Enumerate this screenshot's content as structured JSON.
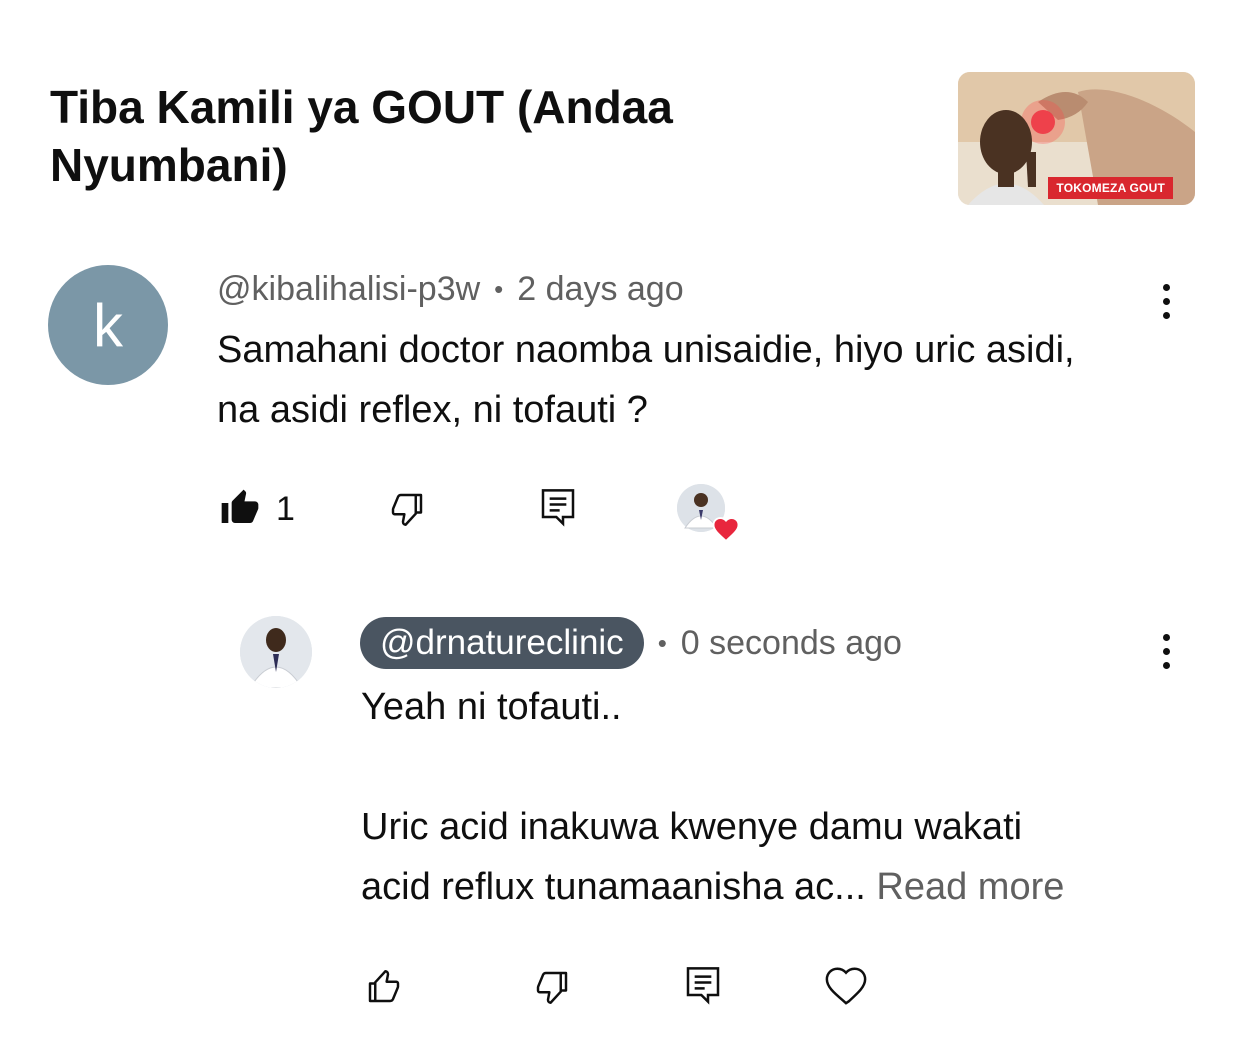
{
  "video": {
    "title": "Tiba Kamili ya GOUT (Andaa Nyumbani)",
    "thumbnail_caption": "TOKOMEZA GOUT"
  },
  "comment": {
    "avatar_letter": "k",
    "handle": "@kibalihalisi-p3w",
    "separator": "•",
    "time": "2 days ago",
    "text": "Samahani doctor naomba unisaidie, hiyo uric asidi, na asidi reflex, ni tofauti ?",
    "like_count": "1",
    "icons": {
      "like": "thumbs-up-filled-icon",
      "dislike": "thumbs-down-icon",
      "reply": "reply-icon",
      "creator_heart": "creator-heart-icon",
      "more": "more-vert-icon"
    }
  },
  "reply": {
    "handle": "@drnatureclinic",
    "separator": "•",
    "time": "0 seconds ago",
    "text_line1": "Yeah ni tofauti..",
    "text_line2": "Uric acid inakuwa kwenye damu wakati",
    "text_line3": "acid reflux tunamaanisha ac...",
    "read_more": "Read more",
    "icons": {
      "like": "thumbs-up-icon",
      "dislike": "thumbs-down-icon",
      "reply": "reply-icon",
      "heart": "heart-outline-icon",
      "more": "more-vert-icon"
    }
  },
  "colors": {
    "text_primary": "#0f0f0f",
    "text_secondary": "#606060",
    "avatar_bg": "#7b97a7",
    "handle_chip_bg": "#4a5561",
    "heart_red": "#e8263d"
  }
}
